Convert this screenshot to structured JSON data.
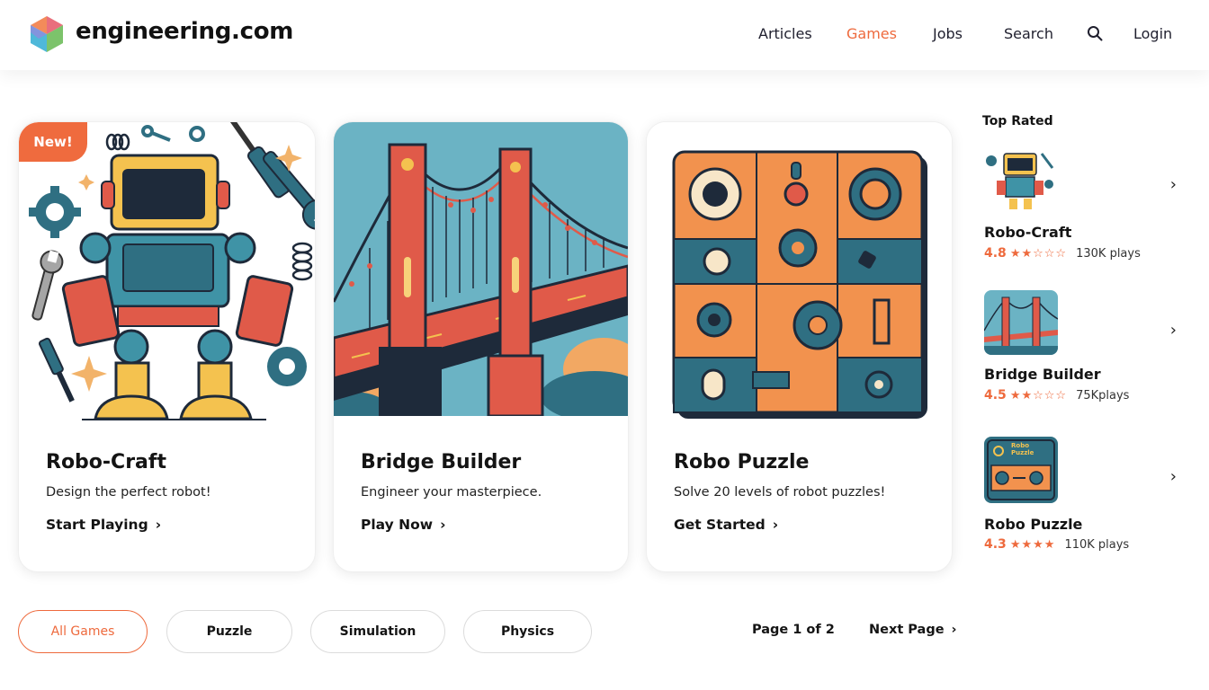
{
  "header": {
    "brand": "engineering.com",
    "logo_icon": "cube-logo-icon",
    "nav": [
      {
        "label": "Articles",
        "active": false
      },
      {
        "label": "Games",
        "active": true
      },
      {
        "label": "Jobs",
        "active": false
      },
      {
        "label": "Search",
        "active": false
      }
    ],
    "search_icon": "search-icon",
    "login_label": "Login"
  },
  "colors": {
    "accent": "#ee6a3d",
    "teal": "#3f7f8e",
    "sky": "#6bb3c4",
    "navy": "#1e2a3a",
    "yellow": "#f4c24f",
    "red": "#e05a49"
  },
  "cards": [
    {
      "badge": "New!",
      "title": "Robo-Craft",
      "description": "Design the perfect robot!",
      "cta": "Start Playing",
      "art": "robot-illustration"
    },
    {
      "badge": "",
      "title": "Bridge Builder",
      "description": "Engineer your masterpiece.",
      "cta": "Play Now",
      "art": "bridge-illustration"
    },
    {
      "badge": "",
      "title": "Robo Puzzle",
      "description": "Solve 20 levels of robot puzzles!",
      "cta": "Get Started",
      "art": "gear-puzzle-illustration"
    }
  ],
  "sidebar": {
    "title": "Top Rated",
    "items": [
      {
        "name": "Robo-Craft",
        "rating": "4.8",
        "stars": "★★☆☆☆",
        "plays": "130K plays"
      },
      {
        "name": "Bridge Builder",
        "rating": "4.5",
        "stars": "★★☆☆☆",
        "plays": "75Kplays"
      },
      {
        "name": "Robo Puzzle",
        "rating": "4.3",
        "stars": "★★★★",
        "plays": "110K plays"
      }
    ],
    "thumb_puzzle_text": "Robo Puzzle"
  },
  "filters": [
    {
      "label": "All Games",
      "active": true
    },
    {
      "label": "Puzzle",
      "active": false
    },
    {
      "label": "Simulation",
      "active": false
    },
    {
      "label": "Physics",
      "active": false
    }
  ],
  "pagination": {
    "status": "Page 1 of 2",
    "next_label": "Next Page"
  }
}
